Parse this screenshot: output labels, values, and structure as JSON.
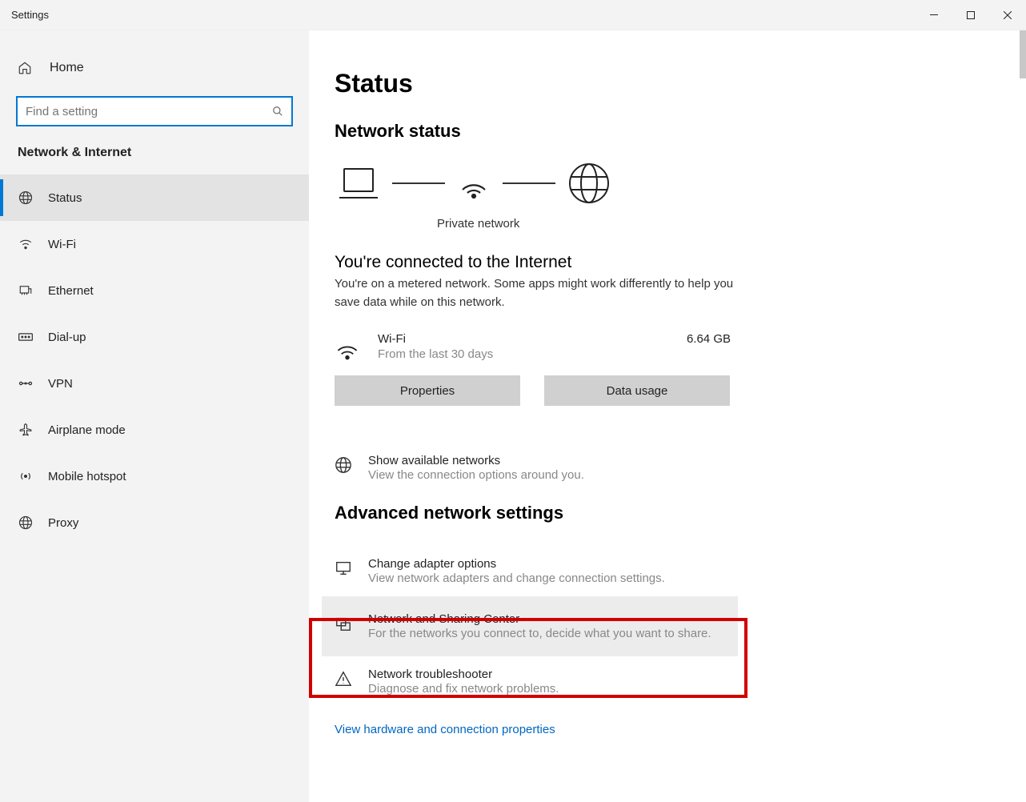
{
  "window": {
    "title": "Settings"
  },
  "sidebar": {
    "home": "Home",
    "search_placeholder": "Find a setting",
    "category": "Network & Internet",
    "items": [
      {
        "label": "Status",
        "icon": "globe",
        "active": true
      },
      {
        "label": "Wi-Fi",
        "icon": "wifi"
      },
      {
        "label": "Ethernet",
        "icon": "ethernet"
      },
      {
        "label": "Dial-up",
        "icon": "dialup"
      },
      {
        "label": "VPN",
        "icon": "vpn"
      },
      {
        "label": "Airplane mode",
        "icon": "airplane"
      },
      {
        "label": "Mobile hotspot",
        "icon": "hotspot"
      },
      {
        "label": "Proxy",
        "icon": "globe"
      }
    ]
  },
  "main": {
    "title": "Status",
    "section": "Network status",
    "network_type": "Private network",
    "connected_title": "You're connected to the Internet",
    "connected_desc": "You're on a metered network. Some apps might work differently to help you save data while on this network.",
    "usage": {
      "name": "Wi-Fi",
      "period": "From the last 30 days",
      "amount": "6.64 GB"
    },
    "buttons": {
      "properties": "Properties",
      "data_usage": "Data usage"
    },
    "options": {
      "show_networks": {
        "title": "Show available networks",
        "desc": "View the connection options around you."
      }
    },
    "advanced_title": "Advanced network settings",
    "advanced": [
      {
        "title": "Change adapter options",
        "desc": "View network adapters and change connection settings.",
        "icon": "monitor"
      },
      {
        "title": "Network and Sharing Center",
        "desc": "For the networks you connect to, decide what you want to share.",
        "icon": "share",
        "hover": true
      },
      {
        "title": "Network troubleshooter",
        "desc": "Diagnose and fix network problems.",
        "icon": "warning"
      }
    ],
    "link": "View hardware and connection properties"
  }
}
